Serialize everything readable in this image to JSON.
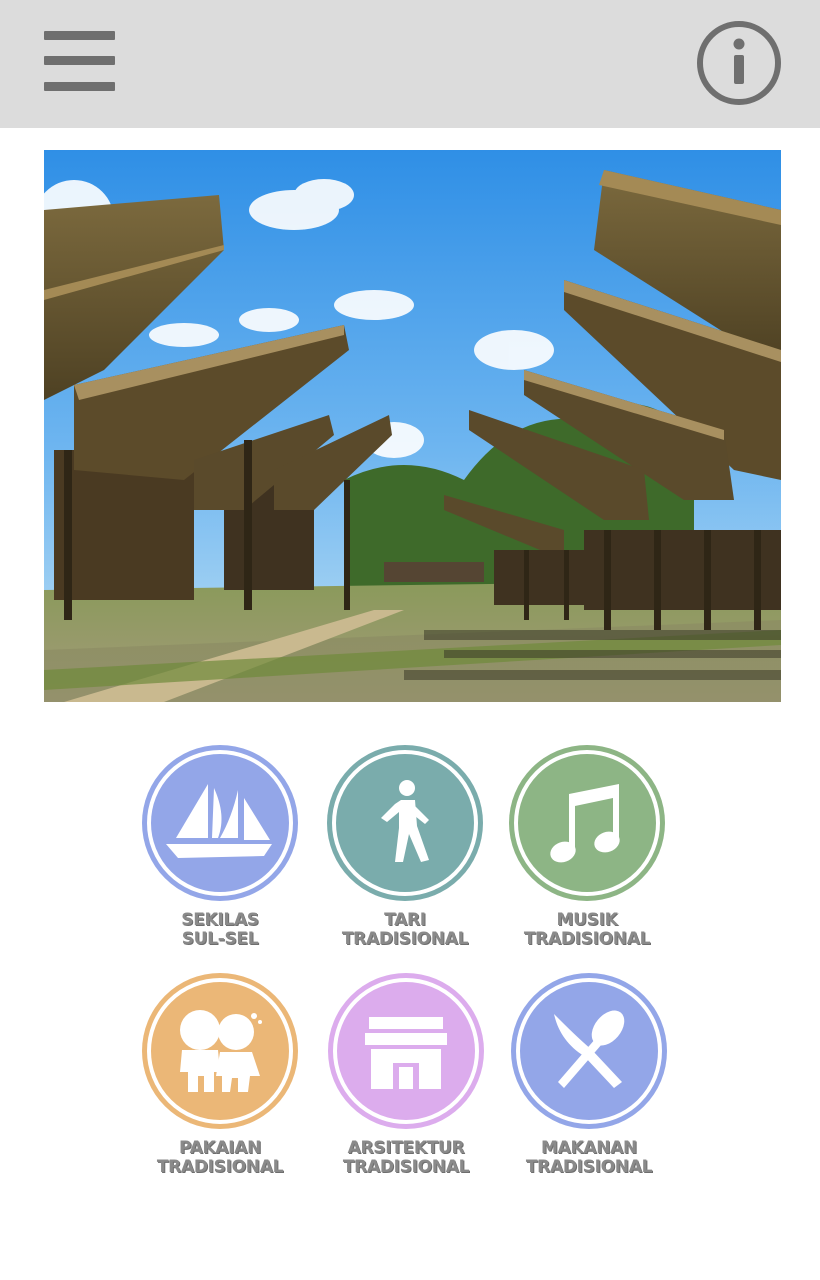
{
  "header": {
    "menu_icon": "hamburger-menu-icon",
    "info_icon": "info-icon",
    "bar_color": "#dcdcdc",
    "icon_color": "#6f6f6f"
  },
  "hero": {
    "subject": "Tongkonan traditional houses"
  },
  "menu": [
    {
      "line1": "SEKILAS",
      "line2": "SUL-SEL",
      "icon": "sailboat-icon",
      "color": "#93a6e8"
    },
    {
      "line1": "TARI",
      "line2": "TRADISIONAL",
      "icon": "walking-person-icon",
      "color": "#7aacac"
    },
    {
      "line1": "MUSIK",
      "line2": "TRADISIONAL",
      "icon": "music-note-icon",
      "color": "#8db585"
    },
    {
      "line1": "PAKAIAN",
      "line2": "TRADISIONAL",
      "icon": "children-icon",
      "color": "#ebb777"
    },
    {
      "line1": "ARSITEKTUR",
      "line2": "TRADISIONAL",
      "icon": "house-icon",
      "color": "#dcaced"
    },
    {
      "line1": "MAKANAN",
      "line2": "TRADISIONAL",
      "icon": "fork-spoon-icon",
      "color": "#93a6e8"
    }
  ]
}
